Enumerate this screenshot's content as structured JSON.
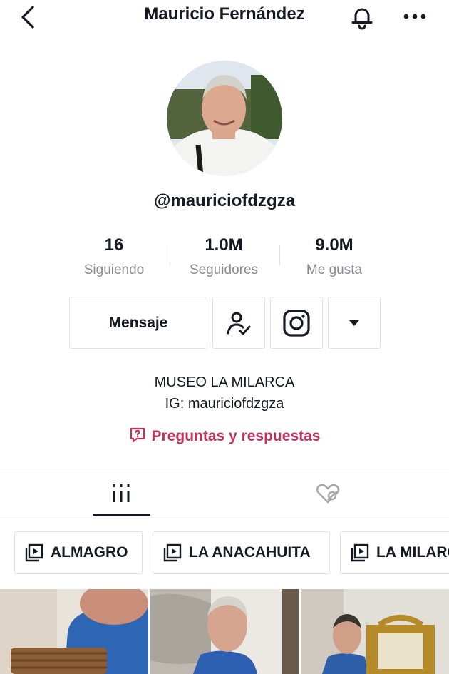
{
  "header": {
    "title": "Mauricio Fernández"
  },
  "profile": {
    "handle": "@mauriciofdzgza"
  },
  "stats": [
    {
      "value": "16",
      "label": "Siguiendo"
    },
    {
      "value": "1.0M",
      "label": "Seguidores"
    },
    {
      "value": "9.0M",
      "label": "Me gusta"
    }
  ],
  "actions": {
    "message_label": "Mensaje"
  },
  "bio": {
    "line1": "MUSEO LA MILARCA",
    "line2": "IG: mauriciofdzgza",
    "qa_label": "Preguntas y respuestas"
  },
  "tabs": [
    {
      "icon": "grid-icon",
      "active": true
    },
    {
      "icon": "liked-hidden-icon",
      "active": false
    }
  ],
  "playlists": [
    {
      "label": "ALMAGRO"
    },
    {
      "label": "LA ANACAHUITA"
    },
    {
      "label": "LA MILARCA"
    }
  ],
  "colors": {
    "accent": "#c1325a",
    "text": "#161823",
    "muted": "#8a8b91",
    "border": "#e3e3e4"
  }
}
